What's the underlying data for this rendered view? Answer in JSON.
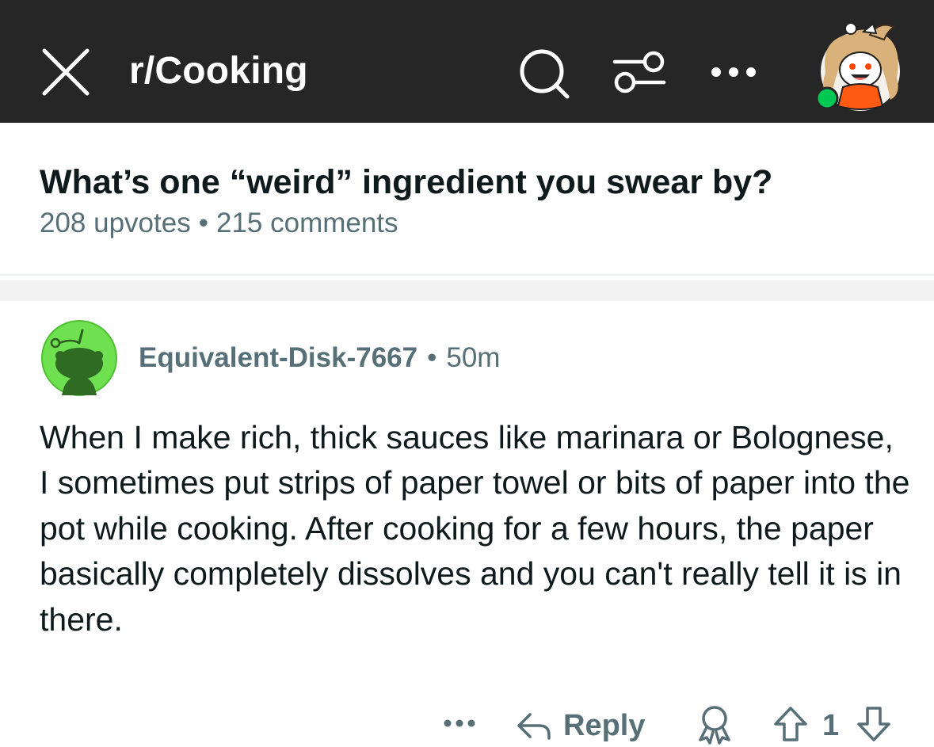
{
  "header": {
    "subreddit": "r/Cooking",
    "icons": [
      "close-icon",
      "search-icon",
      "filter-icon",
      "more-icon",
      "avatar"
    ],
    "background": "#262626",
    "online_status_color": "#00c852"
  },
  "post": {
    "title": "What’s one “weird” ingredient you swear by?",
    "upvotes": "208 upvotes",
    "separator": "•",
    "comments": "215 comments"
  },
  "comment": {
    "author": "Equivalent-Disk-7667",
    "separator": "•",
    "time": "50m",
    "avatar_color": "#6fe04f",
    "body": "When I make rich, thick sauces like marinara or Bolognese, I sometimes put strips of paper towel or bits of paper into the pot while cooking. After cooking for a few hours, the paper basically completely dissolves and you can't really tell it is in there.",
    "actions": {
      "more": "•••",
      "reply": "Reply",
      "vote_count": "1",
      "icons": [
        "more-icon",
        "reply-arrow-icon",
        "award-icon",
        "upvote-icon",
        "downvote-icon"
      ]
    }
  }
}
